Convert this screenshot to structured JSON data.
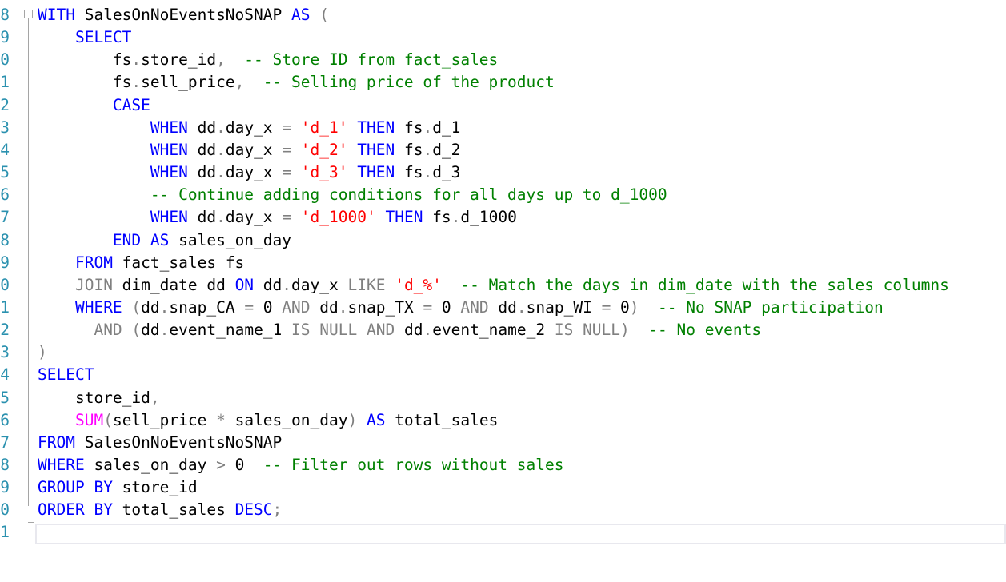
{
  "editor": {
    "line_numbers": [
      "8",
      "9",
      "0",
      "1",
      "2",
      "3",
      "4",
      "5",
      "6",
      "7",
      "8",
      "9",
      "0",
      "1",
      "2",
      "3",
      "4",
      "5",
      "6",
      "7",
      "8",
      "9",
      "0",
      "1"
    ],
    "lines": [
      [
        {
          "t": "WITH",
          "c": "kw"
        },
        {
          "t": " SalesOnNoEventsNoSNAP ",
          "c": "id"
        },
        {
          "t": "AS",
          "c": "kw"
        },
        {
          "t": " (",
          "c": "op"
        }
      ],
      [
        {
          "t": "    ",
          "c": "id"
        },
        {
          "t": "SELECT",
          "c": "kw"
        }
      ],
      [
        {
          "t": "        fs",
          "c": "id"
        },
        {
          "t": ".",
          "c": "op"
        },
        {
          "t": "store_id",
          "c": "id"
        },
        {
          "t": ",",
          "c": "op"
        },
        {
          "t": "  -- Store ID from fact_sales",
          "c": "cmt"
        }
      ],
      [
        {
          "t": "        fs",
          "c": "id"
        },
        {
          "t": ".",
          "c": "op"
        },
        {
          "t": "sell_price",
          "c": "id"
        },
        {
          "t": ",",
          "c": "op"
        },
        {
          "t": "  -- Selling price of the product",
          "c": "cmt"
        }
      ],
      [
        {
          "t": "        ",
          "c": "id"
        },
        {
          "t": "CASE",
          "c": "kw"
        }
      ],
      [
        {
          "t": "            ",
          "c": "id"
        },
        {
          "t": "WHEN",
          "c": "kw"
        },
        {
          "t": " dd",
          "c": "id"
        },
        {
          "t": ".",
          "c": "op"
        },
        {
          "t": "day_x ",
          "c": "id"
        },
        {
          "t": "=",
          "c": "op"
        },
        {
          "t": " ",
          "c": "id"
        },
        {
          "t": "'d_1'",
          "c": "str"
        },
        {
          "t": " ",
          "c": "id"
        },
        {
          "t": "THEN",
          "c": "kw"
        },
        {
          "t": " fs",
          "c": "id"
        },
        {
          "t": ".",
          "c": "op"
        },
        {
          "t": "d_1",
          "c": "id"
        }
      ],
      [
        {
          "t": "            ",
          "c": "id"
        },
        {
          "t": "WHEN",
          "c": "kw"
        },
        {
          "t": " dd",
          "c": "id"
        },
        {
          "t": ".",
          "c": "op"
        },
        {
          "t": "day_x ",
          "c": "id"
        },
        {
          "t": "=",
          "c": "op"
        },
        {
          "t": " ",
          "c": "id"
        },
        {
          "t": "'d_2'",
          "c": "str"
        },
        {
          "t": " ",
          "c": "id"
        },
        {
          "t": "THEN",
          "c": "kw"
        },
        {
          "t": " fs",
          "c": "id"
        },
        {
          "t": ".",
          "c": "op"
        },
        {
          "t": "d_2",
          "c": "id"
        }
      ],
      [
        {
          "t": "            ",
          "c": "id"
        },
        {
          "t": "WHEN",
          "c": "kw"
        },
        {
          "t": " dd",
          "c": "id"
        },
        {
          "t": ".",
          "c": "op"
        },
        {
          "t": "day_x ",
          "c": "id"
        },
        {
          "t": "=",
          "c": "op"
        },
        {
          "t": " ",
          "c": "id"
        },
        {
          "t": "'d_3'",
          "c": "str"
        },
        {
          "t": " ",
          "c": "id"
        },
        {
          "t": "THEN",
          "c": "kw"
        },
        {
          "t": " fs",
          "c": "id"
        },
        {
          "t": ".",
          "c": "op"
        },
        {
          "t": "d_3",
          "c": "id"
        }
      ],
      [
        {
          "t": "            ",
          "c": "id"
        },
        {
          "t": "-- Continue adding conditions for all days up to d_1000",
          "c": "cmt"
        }
      ],
      [
        {
          "t": "            ",
          "c": "id"
        },
        {
          "t": "WHEN",
          "c": "kw"
        },
        {
          "t": " dd",
          "c": "id"
        },
        {
          "t": ".",
          "c": "op"
        },
        {
          "t": "day_x ",
          "c": "id"
        },
        {
          "t": "=",
          "c": "op"
        },
        {
          "t": " ",
          "c": "id"
        },
        {
          "t": "'d_1000'",
          "c": "str"
        },
        {
          "t": " ",
          "c": "id"
        },
        {
          "t": "THEN",
          "c": "kw"
        },
        {
          "t": " fs",
          "c": "id"
        },
        {
          "t": ".",
          "c": "op"
        },
        {
          "t": "d_1000",
          "c": "id"
        }
      ],
      [
        {
          "t": "        ",
          "c": "id"
        },
        {
          "t": "END",
          "c": "kw"
        },
        {
          "t": " ",
          "c": "id"
        },
        {
          "t": "AS",
          "c": "kw"
        },
        {
          "t": " sales_on_day",
          "c": "id"
        }
      ],
      [
        {
          "t": "    ",
          "c": "id"
        },
        {
          "t": "FROM",
          "c": "kw"
        },
        {
          "t": " fact_sales fs",
          "c": "id"
        }
      ],
      [
        {
          "t": "    ",
          "c": "id"
        },
        {
          "t": "JOIN",
          "c": "op"
        },
        {
          "t": " dim_date dd ",
          "c": "id"
        },
        {
          "t": "ON",
          "c": "kw"
        },
        {
          "t": " dd",
          "c": "id"
        },
        {
          "t": ".",
          "c": "op"
        },
        {
          "t": "day_x ",
          "c": "id"
        },
        {
          "t": "LIKE",
          "c": "op"
        },
        {
          "t": " ",
          "c": "id"
        },
        {
          "t": "'d_%'",
          "c": "str"
        },
        {
          "t": "  -- Match the days in dim_date with the sales columns",
          "c": "cmt"
        }
      ],
      [
        {
          "t": "    ",
          "c": "id"
        },
        {
          "t": "WHERE",
          "c": "kw"
        },
        {
          "t": " (",
          "c": "op"
        },
        {
          "t": "dd",
          "c": "id"
        },
        {
          "t": ".",
          "c": "op"
        },
        {
          "t": "snap_CA ",
          "c": "id"
        },
        {
          "t": "=",
          "c": "op"
        },
        {
          "t": " 0 ",
          "c": "id"
        },
        {
          "t": "AND",
          "c": "op"
        },
        {
          "t": " dd",
          "c": "id"
        },
        {
          "t": ".",
          "c": "op"
        },
        {
          "t": "snap_TX ",
          "c": "id"
        },
        {
          "t": "=",
          "c": "op"
        },
        {
          "t": " 0 ",
          "c": "id"
        },
        {
          "t": "AND",
          "c": "op"
        },
        {
          "t": " dd",
          "c": "id"
        },
        {
          "t": ".",
          "c": "op"
        },
        {
          "t": "snap_WI ",
          "c": "id"
        },
        {
          "t": "=",
          "c": "op"
        },
        {
          "t": " 0",
          "c": "id"
        },
        {
          "t": ")",
          "c": "op"
        },
        {
          "t": "  -- No SNAP participation",
          "c": "cmt"
        }
      ],
      [
        {
          "t": "      ",
          "c": "id"
        },
        {
          "t": "AND",
          "c": "op"
        },
        {
          "t": " (",
          "c": "op"
        },
        {
          "t": "dd",
          "c": "id"
        },
        {
          "t": ".",
          "c": "op"
        },
        {
          "t": "event_name_1 ",
          "c": "id"
        },
        {
          "t": "IS",
          "c": "op"
        },
        {
          "t": " ",
          "c": "id"
        },
        {
          "t": "NULL",
          "c": "op"
        },
        {
          "t": " ",
          "c": "id"
        },
        {
          "t": "AND",
          "c": "op"
        },
        {
          "t": " dd",
          "c": "id"
        },
        {
          "t": ".",
          "c": "op"
        },
        {
          "t": "event_name_2 ",
          "c": "id"
        },
        {
          "t": "IS",
          "c": "op"
        },
        {
          "t": " ",
          "c": "id"
        },
        {
          "t": "NULL",
          "c": "op"
        },
        {
          "t": ")",
          "c": "op"
        },
        {
          "t": "  -- No events",
          "c": "cmt"
        }
      ],
      [
        {
          "t": ")",
          "c": "op"
        }
      ],
      [
        {
          "t": "SELECT",
          "c": "kw"
        }
      ],
      [
        {
          "t": "    store_id",
          "c": "id"
        },
        {
          "t": ",",
          "c": "op"
        }
      ],
      [
        {
          "t": "    ",
          "c": "id"
        },
        {
          "t": "SUM",
          "c": "fn"
        },
        {
          "t": "(",
          "c": "op"
        },
        {
          "t": "sell_price ",
          "c": "id"
        },
        {
          "t": "*",
          "c": "op"
        },
        {
          "t": " sales_on_day",
          "c": "id"
        },
        {
          "t": ")",
          "c": "op"
        },
        {
          "t": " ",
          "c": "id"
        },
        {
          "t": "AS",
          "c": "kw"
        },
        {
          "t": " total_sales",
          "c": "id"
        }
      ],
      [
        {
          "t": "FROM",
          "c": "kw"
        },
        {
          "t": " SalesOnNoEventsNoSNAP",
          "c": "id"
        }
      ],
      [
        {
          "t": "WHERE",
          "c": "kw"
        },
        {
          "t": " sales_on_day ",
          "c": "id"
        },
        {
          "t": ">",
          "c": "op"
        },
        {
          "t": " 0  ",
          "c": "id"
        },
        {
          "t": "-- Filter out rows without sales",
          "c": "cmt"
        }
      ],
      [
        {
          "t": "GROUP",
          "c": "kw"
        },
        {
          "t": " ",
          "c": "id"
        },
        {
          "t": "BY",
          "c": "kw"
        },
        {
          "t": " store_id",
          "c": "id"
        }
      ],
      [
        {
          "t": "ORDER",
          "c": "kw"
        },
        {
          "t": " ",
          "c": "id"
        },
        {
          "t": "BY",
          "c": "kw"
        },
        {
          "t": " total_sales ",
          "c": "id"
        },
        {
          "t": "DESC",
          "c": "kw"
        },
        {
          "t": ";",
          "c": "op"
        }
      ],
      []
    ]
  }
}
